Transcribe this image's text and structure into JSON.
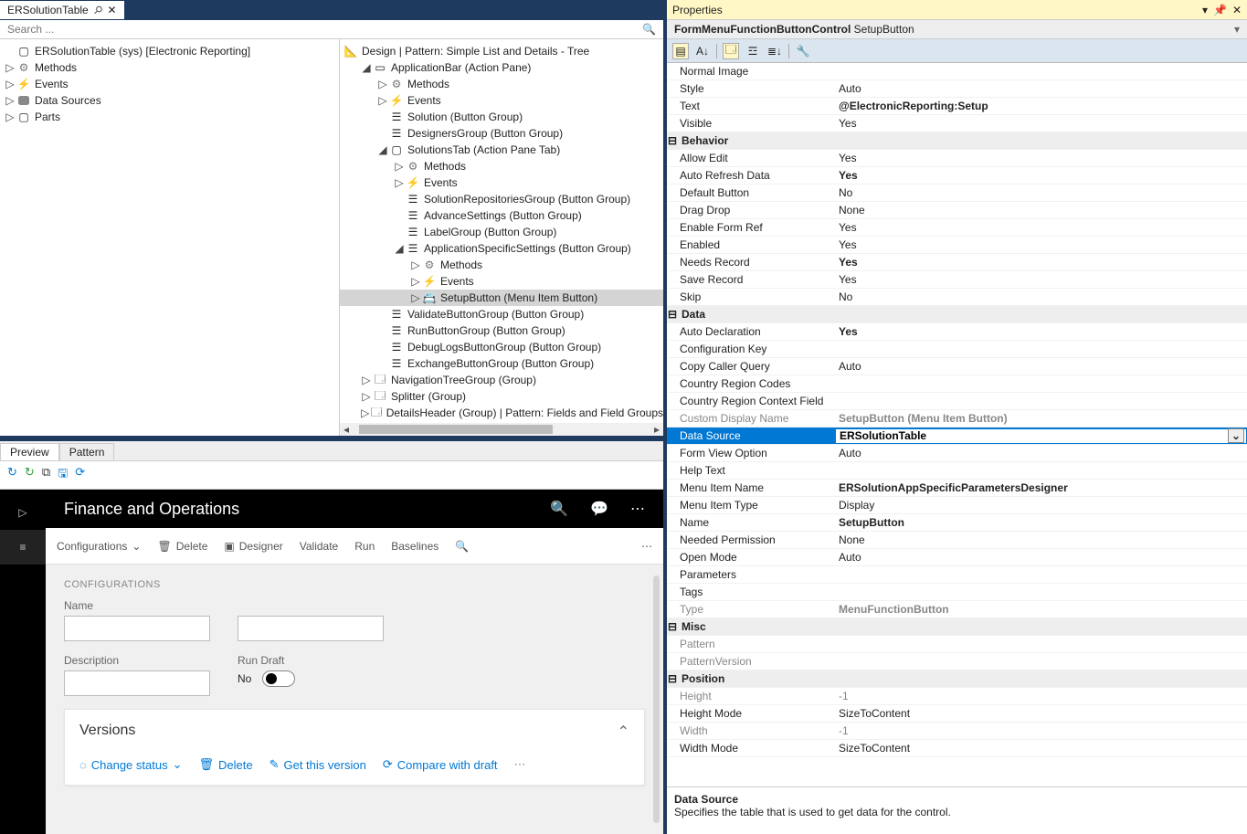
{
  "tab": {
    "title": "ERSolutionTable",
    "pinned": true
  },
  "search": {
    "placeholder": "Search ..."
  },
  "aot": {
    "root": "ERSolutionTable (sys) [Electronic Reporting]",
    "nodes": [
      "Methods",
      "Events",
      "Data Sources",
      "Parts"
    ]
  },
  "design": {
    "header": "Design | Pattern: Simple List and Details - Tree",
    "nodes": [
      {
        "d": 1,
        "exp": "open",
        "icon": "box",
        "t": "ApplicationBar (Action Pane)"
      },
      {
        "d": 2,
        "exp": "closed",
        "icon": "gear",
        "t": "Methods"
      },
      {
        "d": 2,
        "exp": "closed",
        "icon": "bolt",
        "t": "Events"
      },
      {
        "d": 2,
        "exp": "",
        "icon": "grp",
        "t": "Solution (Button Group)"
      },
      {
        "d": 2,
        "exp": "",
        "icon": "grp",
        "t": "DesignersGroup (Button Group)"
      },
      {
        "d": 2,
        "exp": "open",
        "icon": "tab",
        "t": "SolutionsTab (Action Pane Tab)"
      },
      {
        "d": 3,
        "exp": "closed",
        "icon": "gear",
        "t": "Methods"
      },
      {
        "d": 3,
        "exp": "closed",
        "icon": "bolt",
        "t": "Events"
      },
      {
        "d": 3,
        "exp": "",
        "icon": "grp",
        "t": "SolutionRepositoriesGroup (Button Group)"
      },
      {
        "d": 3,
        "exp": "",
        "icon": "grp",
        "t": "AdvanceSettings (Button Group)"
      },
      {
        "d": 3,
        "exp": "",
        "icon": "grp",
        "t": "LabelGroup (Button Group)"
      },
      {
        "d": 3,
        "exp": "open",
        "icon": "grp",
        "t": "ApplicationSpecificSettings (Button Group)"
      },
      {
        "d": 4,
        "exp": "closed",
        "icon": "gear",
        "t": "Methods"
      },
      {
        "d": 4,
        "exp": "closed",
        "icon": "bolt",
        "t": "Events"
      },
      {
        "d": 4,
        "exp": "closed",
        "icon": "menu",
        "t": "SetupButton (Menu Item Button)",
        "sel": true
      },
      {
        "d": 2,
        "exp": "",
        "icon": "grp",
        "t": "ValidateButtonGroup (Button Group)"
      },
      {
        "d": 2,
        "exp": "",
        "icon": "grp",
        "t": "RunButtonGroup (Button Group)"
      },
      {
        "d": 2,
        "exp": "",
        "icon": "grp",
        "t": "DebugLogsButtonGroup (Button Group)"
      },
      {
        "d": 2,
        "exp": "",
        "icon": "grp",
        "t": "ExchangeButtonGroup (Button Group)"
      },
      {
        "d": 1,
        "exp": "closed",
        "icon": "panel",
        "t": "NavigationTreeGroup (Group)"
      },
      {
        "d": 1,
        "exp": "closed",
        "icon": "panel",
        "t": "Splitter (Group)"
      },
      {
        "d": 1,
        "exp": "closed",
        "icon": "panel",
        "t": "DetailsHeader (Group) | Pattern: Fields and Field Groups"
      }
    ]
  },
  "preview": {
    "tabs": [
      "Preview",
      "Pattern"
    ],
    "app_title": "Finance and Operations",
    "actionbar": {
      "config": "Configurations",
      "delete": "Delete",
      "designer": "Designer",
      "validate": "Validate",
      "run": "Run",
      "baselines": "Baselines"
    },
    "section": "CONFIGURATIONS",
    "fields": {
      "name": "Name",
      "description": "Description",
      "rundraft": "Run Draft",
      "rundraft_val": "No"
    },
    "versions": {
      "title": "Versions",
      "links": [
        "Change status",
        "Delete",
        "Get this version",
        "Compare with draft"
      ]
    }
  },
  "props": {
    "title": "Properties",
    "breadcrumb": "FormMenuFunctionButtonControl  SetupButton",
    "rows": [
      {
        "n": "Normal Image",
        "v": ""
      },
      {
        "n": "Style",
        "v": "Auto"
      },
      {
        "n": "Text",
        "v": "@ElectronicReporting:Setup",
        "b": true
      },
      {
        "n": "Visible",
        "v": "Yes"
      },
      {
        "sec": "Behavior"
      },
      {
        "n": "Allow Edit",
        "v": "Yes"
      },
      {
        "n": "Auto Refresh Data",
        "v": "Yes",
        "b": true
      },
      {
        "n": "Default Button",
        "v": "No"
      },
      {
        "n": "Drag Drop",
        "v": "None"
      },
      {
        "n": "Enable Form Ref",
        "v": "Yes"
      },
      {
        "n": "Enabled",
        "v": "Yes"
      },
      {
        "n": "Needs Record",
        "v": "Yes",
        "b": true
      },
      {
        "n": "Save Record",
        "v": "Yes"
      },
      {
        "n": "Skip",
        "v": "No"
      },
      {
        "sec": "Data"
      },
      {
        "n": "Auto Declaration",
        "v": "Yes",
        "b": true
      },
      {
        "n": "Configuration Key",
        "v": ""
      },
      {
        "n": "Copy Caller Query",
        "v": "Auto"
      },
      {
        "n": "Country Region Codes",
        "v": ""
      },
      {
        "n": "Country Region Context Field",
        "v": ""
      },
      {
        "n": "Custom Display Name",
        "v": "SetupButton (Menu Item Button)",
        "d": true,
        "b": true
      },
      {
        "n": "Data Source",
        "v": "ERSolutionTable",
        "sel": true,
        "b": true
      },
      {
        "n": "Form View Option",
        "v": "Auto"
      },
      {
        "n": "Help Text",
        "v": ""
      },
      {
        "n": "Menu Item Name",
        "v": "ERSolutionAppSpecificParametersDesigner",
        "b": true
      },
      {
        "n": "Menu Item Type",
        "v": "Display"
      },
      {
        "n": "Name",
        "v": "SetupButton",
        "b": true
      },
      {
        "n": "Needed Permission",
        "v": "None"
      },
      {
        "n": "Open Mode",
        "v": "Auto"
      },
      {
        "n": "Parameters",
        "v": ""
      },
      {
        "n": "Tags",
        "v": ""
      },
      {
        "n": "Type",
        "v": "MenuFunctionButton",
        "d": true,
        "b": true
      },
      {
        "sec": "Misc"
      },
      {
        "n": "Pattern",
        "v": "",
        "d": true
      },
      {
        "n": "PatternVersion",
        "v": "",
        "d": true
      },
      {
        "sec": "Position"
      },
      {
        "n": "Height",
        "v": "-1",
        "d": true
      },
      {
        "n": "Height Mode",
        "v": "SizeToContent"
      },
      {
        "n": "Width",
        "v": "-1",
        "d": true
      },
      {
        "n": "Width Mode",
        "v": "SizeToContent"
      }
    ],
    "desc_name": "Data Source",
    "desc_text": "Specifies the table that is used to get data for the control."
  }
}
